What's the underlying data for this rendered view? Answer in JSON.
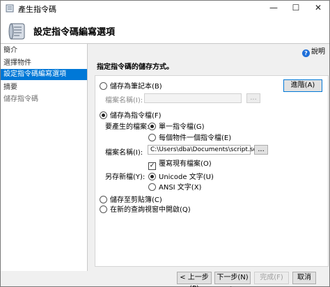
{
  "window": {
    "title": "產生指令碼"
  },
  "header": {
    "heading": "設定指令碼編寫選項"
  },
  "sidebar": {
    "items": [
      {
        "label": "簡介"
      },
      {
        "label": "選擇物件"
      },
      {
        "label": "設定指令碼編寫選項"
      },
      {
        "label": "摘要"
      },
      {
        "label": "儲存指令碼"
      }
    ]
  },
  "main": {
    "help_label": "說明",
    "section_title": "指定指令碼的儲存方式。",
    "save_notebook": {
      "label": "儲存為筆記本(B)",
      "filename_label": "檔案名稱(I):",
      "browse_label": "..."
    },
    "advanced_label": "進階(A)",
    "save_script": {
      "label": "儲存為指令檔(F)",
      "files_label": "要產生的檔案:",
      "single_file": "單一指令檔(G)",
      "per_object": "每個物件一個指令檔(E)",
      "filename_label": "檔案名稱(I):",
      "filename_value": "C:\\Users\\dba\\Documents\\script.sql",
      "browse_label": "...",
      "overwrite_label": "覆寫現有檔案(O)",
      "save_as_label": "另存新檔(Y):",
      "unicode_label": "Unicode 文字(U)",
      "ansi_label": "ANSI 文字(X)"
    },
    "clipboard_label": "儲存至剪貼簿(C)",
    "new_query_label": "在新的查詢視窗中開啟(Q)"
  },
  "footer": {
    "prev_label": "< 上一步(P)",
    "next_label": "下一步(N) >",
    "finish_label": "完成(F)",
    "cancel_label": "取消"
  }
}
